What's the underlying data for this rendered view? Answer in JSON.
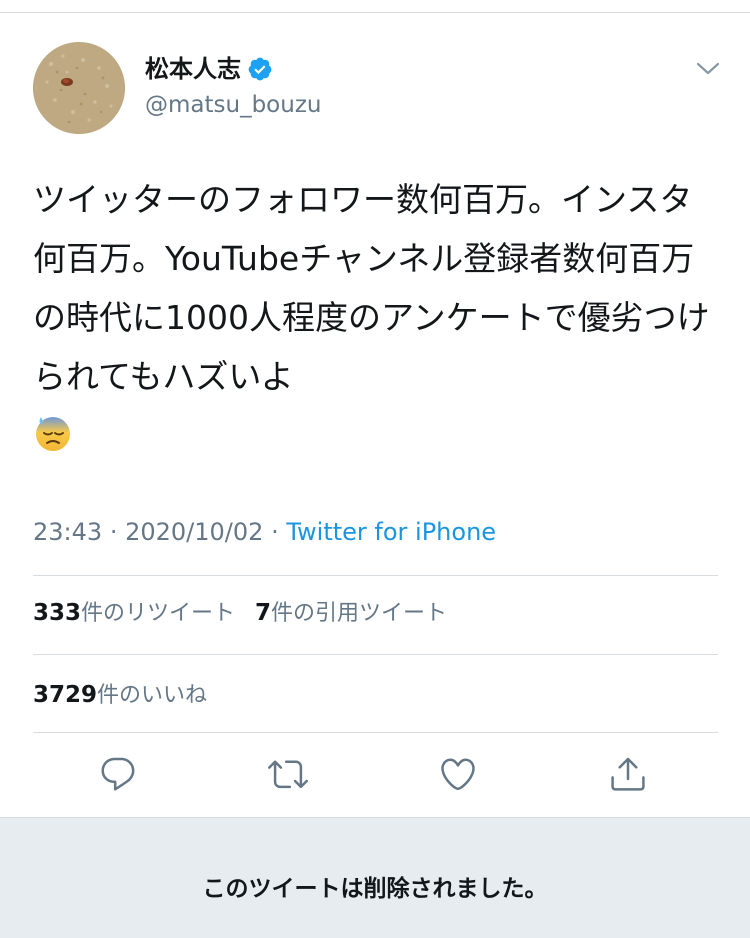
{
  "user": {
    "display_name": "松本人志",
    "handle": "@matsu_bouzu",
    "verified": true
  },
  "tweet": {
    "text": "ツイッターのフォロワー数何百万。インスタ何百万。YouTubeチャンネル登録者数何百万の時代に1000人程度のアンケートで優劣つけられてもハズいよ",
    "emoji": "downcast-face-with-sweat",
    "time": "23:43",
    "separator": "·",
    "date": "2020/10/02",
    "source": "Twitter for iPhone"
  },
  "stats": {
    "retweets_count": "333",
    "retweets_label": "件のリツイート",
    "quotes_count": "7",
    "quotes_label": "件の引用ツイート",
    "likes_count": "3729",
    "likes_label": "件のいいね"
  },
  "actions": [
    "reply-icon",
    "retweet-icon",
    "like-icon",
    "share-icon"
  ],
  "deleted_notice": "このツイートは削除されました。",
  "colors": {
    "link": "#1b95e0",
    "secondary_text": "#657786",
    "verified": "#1da1f2",
    "deleted_bg": "#e6ecf0"
  }
}
